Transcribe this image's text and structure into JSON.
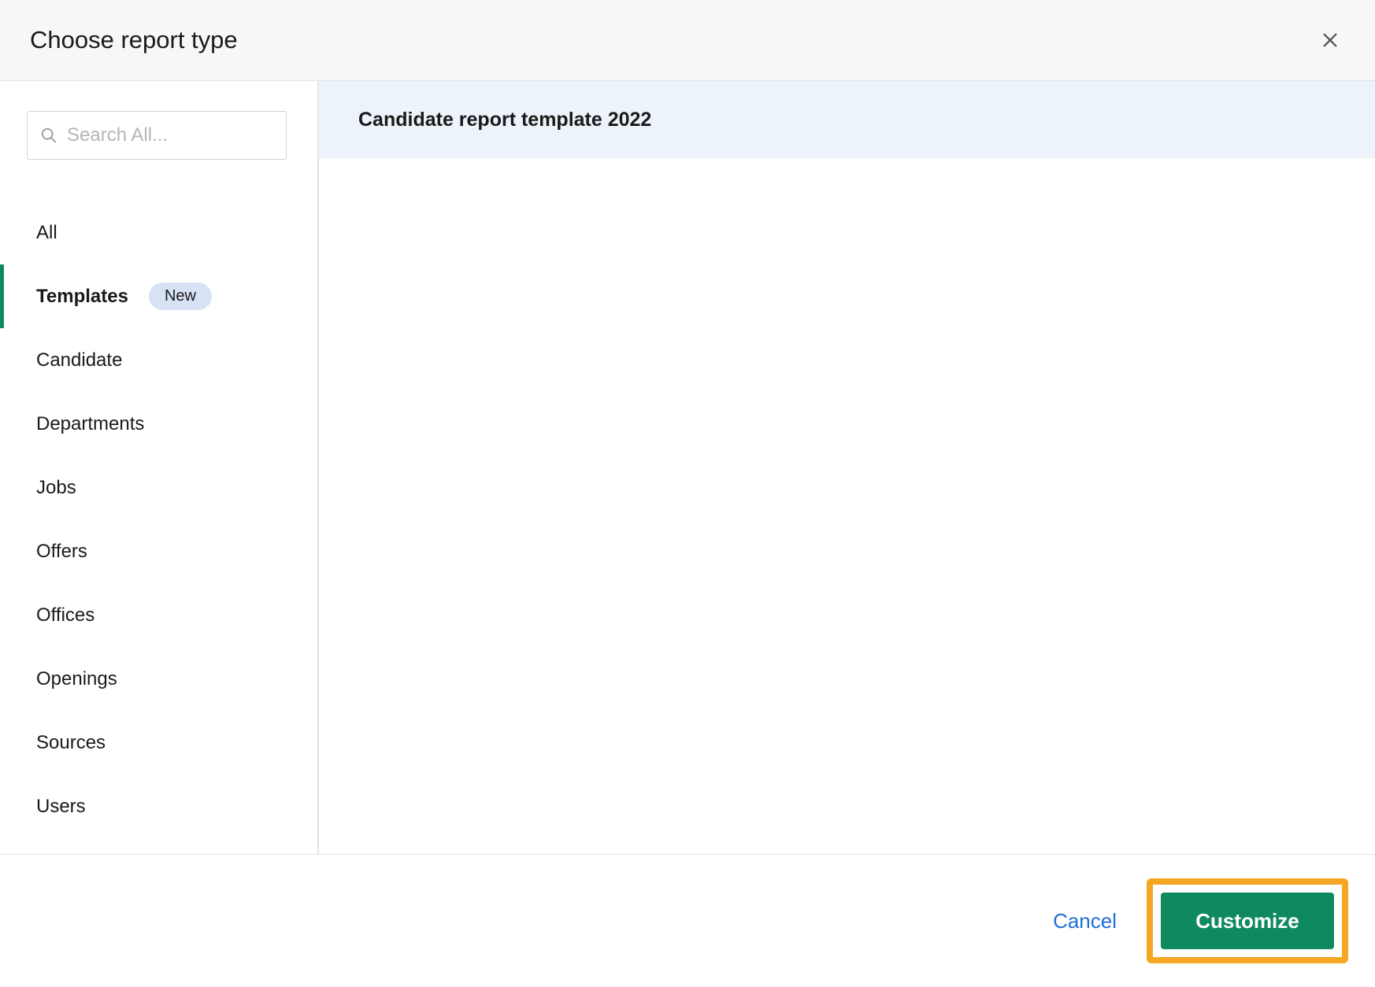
{
  "header": {
    "title": "Choose report type"
  },
  "search": {
    "placeholder": "Search All..."
  },
  "sidebar": {
    "items": [
      {
        "label": "All",
        "active": false,
        "badge": null
      },
      {
        "label": "Templates",
        "active": true,
        "badge": "New"
      },
      {
        "label": "Candidate",
        "active": false,
        "badge": null
      },
      {
        "label": "Departments",
        "active": false,
        "badge": null
      },
      {
        "label": "Jobs",
        "active": false,
        "badge": null
      },
      {
        "label": "Offers",
        "active": false,
        "badge": null
      },
      {
        "label": "Offices",
        "active": false,
        "badge": null
      },
      {
        "label": "Openings",
        "active": false,
        "badge": null
      },
      {
        "label": "Sources",
        "active": false,
        "badge": null
      },
      {
        "label": "Users",
        "active": false,
        "badge": null
      }
    ]
  },
  "main": {
    "selected_report": "Candidate report template 2022"
  },
  "footer": {
    "cancel_label": "Cancel",
    "customize_label": "Customize"
  }
}
